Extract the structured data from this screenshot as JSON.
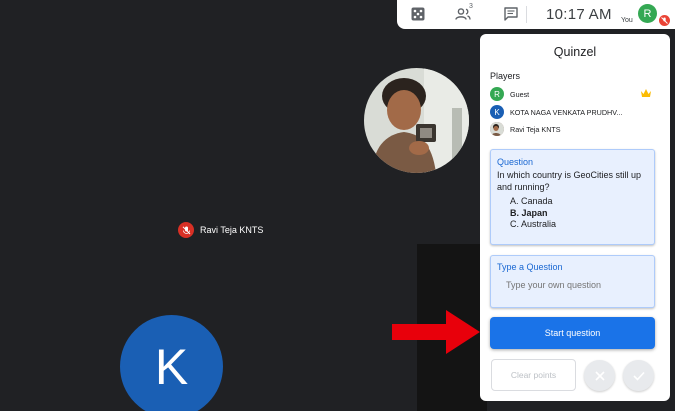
{
  "topbar": {
    "participant_count": "3",
    "time": "10:17 AM",
    "user_initial": "R",
    "user_label": "You"
  },
  "video": {
    "presenter_name": "Ravi Teja KNTS",
    "main_avatar_initial": "K"
  },
  "panel": {
    "title": "Quinzel",
    "players_label": "Players",
    "players": [
      {
        "initial": "R",
        "name": "Guest",
        "color": "#34a853"
      },
      {
        "initial": "K",
        "name": "KOTA NAGA VENKATA PRUDHV...",
        "color": "#1a5fb4"
      },
      {
        "initial": "",
        "name": "Ravi Teja KNTS",
        "color": "#8d6e63"
      }
    ],
    "question": {
      "title": "Question",
      "text": "In which country is GeoCities still up and running?",
      "options": [
        "A.  Canada",
        "B.  Japan",
        "C.  Australia"
      ]
    },
    "type_question": {
      "title": "Type a Question",
      "placeholder": "Type your own question"
    },
    "start_label": "Start question",
    "clear_label": "Clear points"
  },
  "colors": {
    "accent": "#1a73e8",
    "arrow": "#e8000b",
    "crown": "#fbbc04",
    "background": "#202124"
  }
}
